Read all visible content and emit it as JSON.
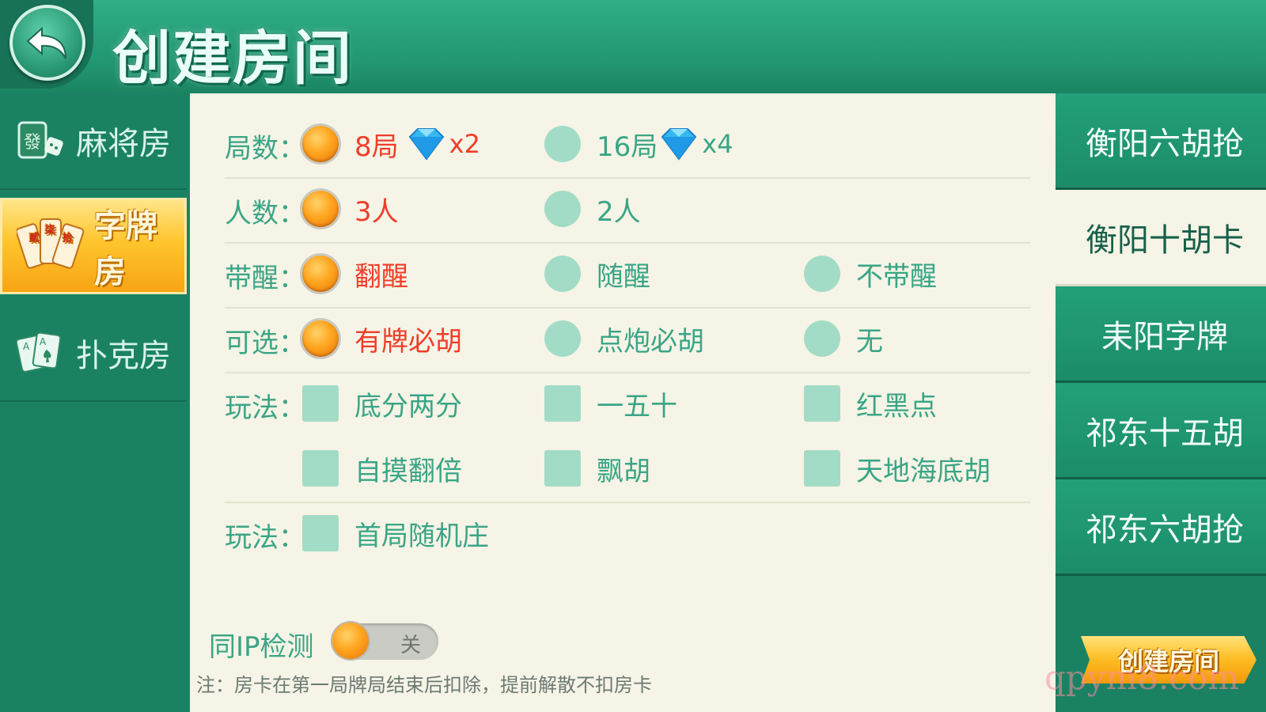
{
  "header": {
    "title": "创建房间"
  },
  "left_nav": [
    {
      "label": "麻将房",
      "icon": "mahjong-tile-icon",
      "active": false
    },
    {
      "label": "字牌房",
      "icon": "zipai-cards-icon",
      "active": true
    },
    {
      "label": "扑克房",
      "icon": "poker-cards-icon",
      "active": false
    }
  ],
  "options": {
    "rounds": {
      "label": "局数：",
      "choices": [
        {
          "text": "8局",
          "selected": true,
          "cost": "x2"
        },
        {
          "text": "16局",
          "selected": false,
          "cost": "x4"
        }
      ]
    },
    "players": {
      "label": "人数：",
      "choices": [
        {
          "text": "3人",
          "selected": true
        },
        {
          "text": "2人",
          "selected": false
        }
      ]
    },
    "xing": {
      "label": "带醒：",
      "choices": [
        {
          "text": "翻醒",
          "selected": true
        },
        {
          "text": "随醒",
          "selected": false
        },
        {
          "text": "不带醒",
          "selected": false
        }
      ]
    },
    "optional": {
      "label": "可选：",
      "choices": [
        {
          "text": "有牌必胡",
          "selected": true
        },
        {
          "text": "点炮必胡",
          "selected": false
        },
        {
          "text": "无",
          "selected": false
        }
      ]
    },
    "play": {
      "label": "玩法：",
      "checks": [
        {
          "text": "底分两分",
          "checked": false
        },
        {
          "text": "一五十",
          "checked": false
        },
        {
          "text": "红黑点",
          "checked": false
        },
        {
          "text": "自摸翻倍",
          "checked": false
        },
        {
          "text": "飘胡",
          "checked": false
        },
        {
          "text": "天地海底胡",
          "checked": false
        }
      ]
    },
    "play2": {
      "label": "玩法：",
      "checks": [
        {
          "text": "首局随机庄",
          "checked": false
        }
      ]
    }
  },
  "ip_check": {
    "label": "同IP检测",
    "state": "关",
    "on": false
  },
  "note": "注：房卡在第一局牌局结束后扣除，提前解散不扣房卡",
  "right_nav": [
    {
      "label": "衡阳六胡抢",
      "active": false
    },
    {
      "label": "衡阳十胡卡",
      "active": true
    },
    {
      "label": "耒阳字牌",
      "active": false
    },
    {
      "label": "祁东十五胡",
      "active": false
    },
    {
      "label": "祁东六胡抢",
      "active": false
    }
  ],
  "create_button": "创建房间",
  "watermark": "qpym8.com",
  "colors": {
    "accent_green": "#3aa586",
    "selected_red": "#ef3e2a",
    "panel_bg": "#f6f4e6",
    "gold": "#ffbb22"
  }
}
